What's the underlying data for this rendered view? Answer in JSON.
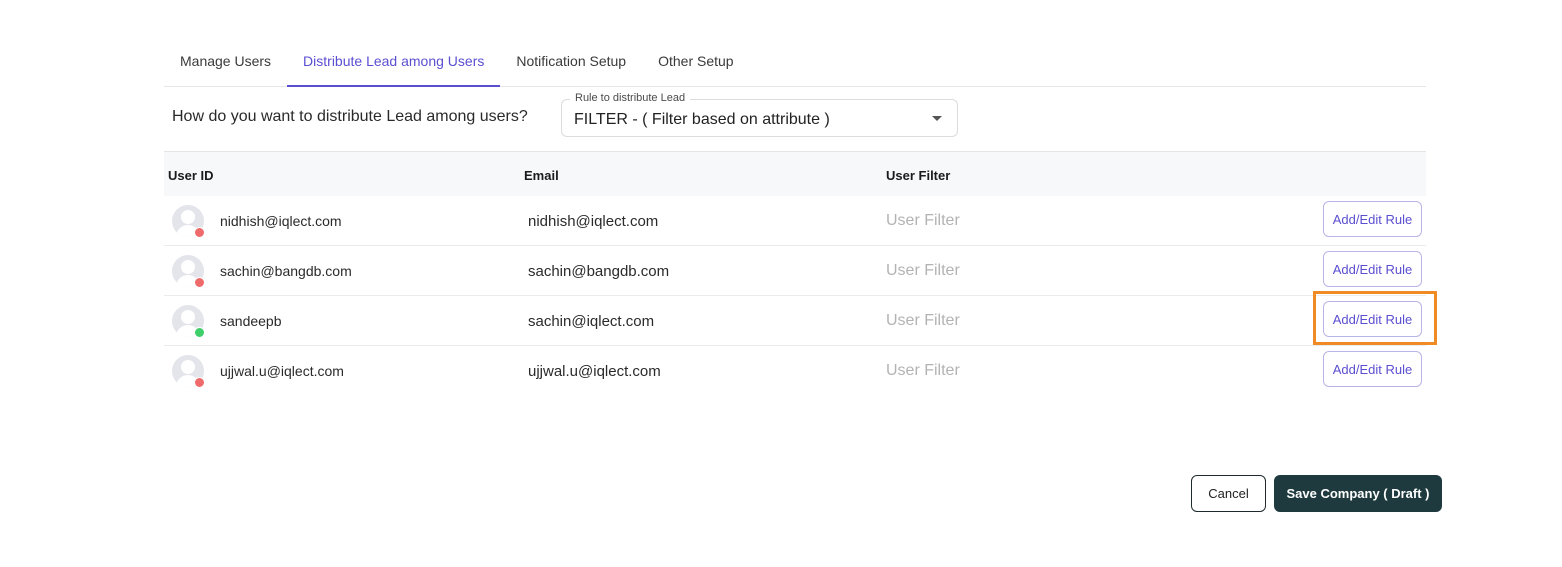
{
  "tabs": [
    {
      "label": "Manage Users",
      "active": false
    },
    {
      "label": "Distribute Lead among Users",
      "active": true
    },
    {
      "label": "Notification Setup",
      "active": false
    },
    {
      "label": "Other Setup",
      "active": false
    }
  ],
  "distribution": {
    "question": "How do you want to distribute Lead among users?",
    "select_label": "Rule to distribute Lead",
    "select_value": "FILTER - ( Filter based on attribute )"
  },
  "table": {
    "headers": {
      "user_id": "User ID",
      "email": "Email",
      "user_filter": "User Filter"
    },
    "rows": [
      {
        "user_id": "nidhish@iqlect.com",
        "email": "nidhish@iqlect.com",
        "filter_placeholder": "User Filter",
        "button_label": "Add/Edit Rule",
        "status": "offline"
      },
      {
        "user_id": "sachin@bangdb.com",
        "email": "sachin@bangdb.com",
        "filter_placeholder": "User Filter",
        "button_label": "Add/Edit Rule",
        "status": "offline"
      },
      {
        "user_id": "sandeepb",
        "email": "sachin@iqlect.com",
        "filter_placeholder": "User Filter",
        "button_label": "Add/Edit Rule",
        "status": "online"
      },
      {
        "user_id": "ujjwal.u@iqlect.com",
        "email": "ujjwal.u@iqlect.com",
        "filter_placeholder": "User Filter",
        "button_label": "Add/Edit Rule",
        "status": "offline"
      }
    ]
  },
  "footer": {
    "cancel_label": "Cancel",
    "save_label": "Save Company ( Draft )"
  },
  "colors": {
    "accent": "#5b4fd1",
    "status_online": "#3ecf6a",
    "status_offline": "#ef6b6b",
    "highlight": "#f08a24",
    "save_button": "#1e3a3e"
  }
}
